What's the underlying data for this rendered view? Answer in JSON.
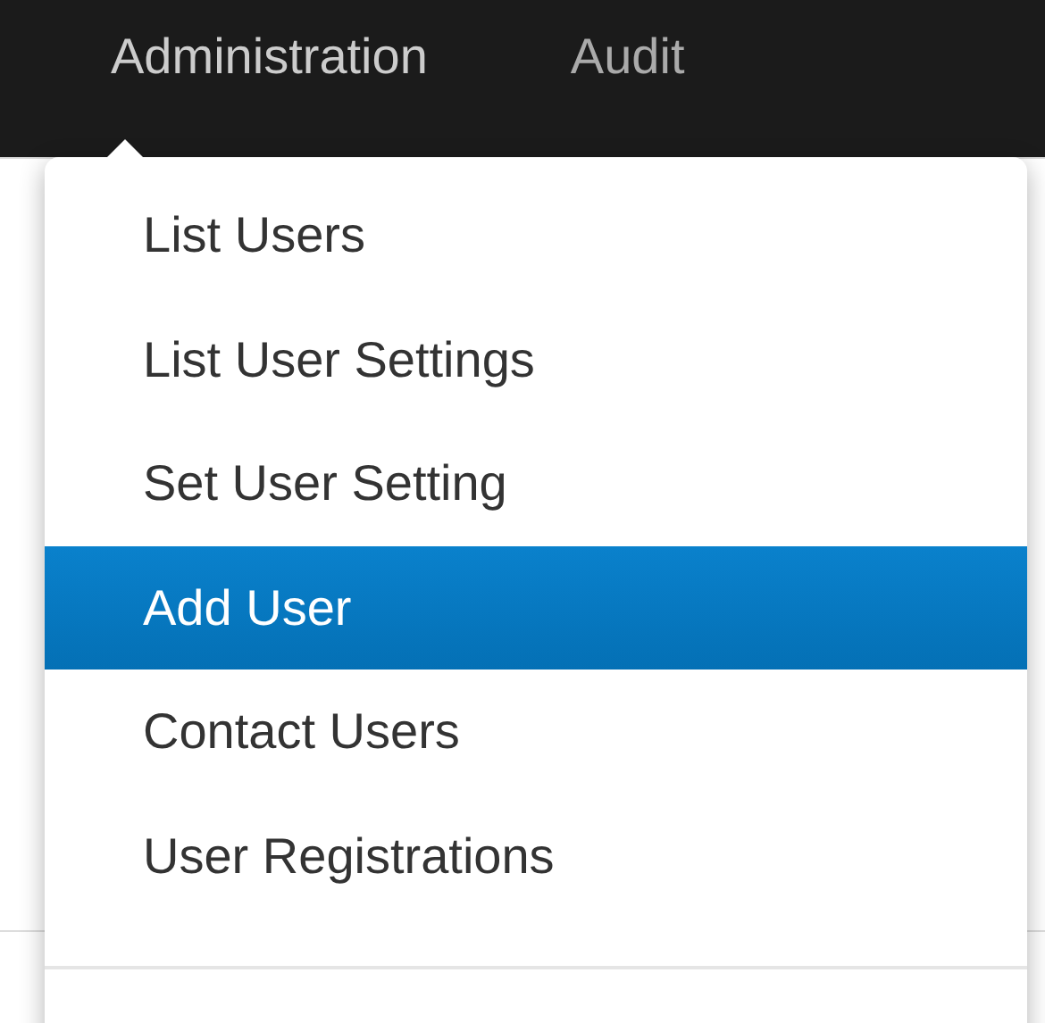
{
  "navbar": {
    "items": [
      {
        "label": "Administration",
        "selected": true
      },
      {
        "label": "Audit",
        "selected": false
      }
    ]
  },
  "dropdown": {
    "items": [
      {
        "label": "List Users",
        "selected": false
      },
      {
        "label": "List User Settings",
        "selected": false
      },
      {
        "label": "Set User Setting",
        "selected": false
      },
      {
        "label": "Add User",
        "selected": true
      },
      {
        "label": "Contact Users",
        "selected": false
      },
      {
        "label": "User Registrations",
        "selected": false
      }
    ]
  }
}
